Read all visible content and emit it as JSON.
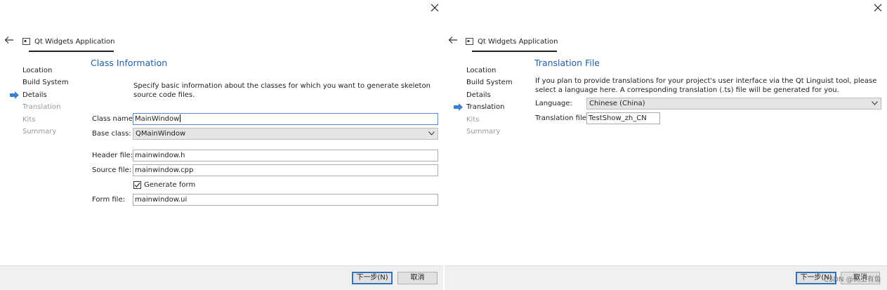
{
  "left": {
    "wizard_title": "Qt Widgets Application",
    "steps": [
      {
        "label": "Location",
        "state": "done"
      },
      {
        "label": "Build System",
        "state": "done"
      },
      {
        "label": "Details",
        "state": "current"
      },
      {
        "label": "Translation",
        "state": "pending"
      },
      {
        "label": "Kits",
        "state": "pending"
      },
      {
        "label": "Summary",
        "state": "pending"
      }
    ],
    "heading": "Class Information",
    "description": "Specify basic information about the classes for which you want to generate skeleton source code files.",
    "class_name": {
      "label": "Class name:",
      "value": "MainWindow"
    },
    "base_class": {
      "label": "Base class:",
      "value": "QMainWindow"
    },
    "header_file": {
      "label": "Header file:",
      "value": "mainwindow.h"
    },
    "source_file": {
      "label": "Source file:",
      "value": "mainwindow.cpp"
    },
    "generate_form": {
      "label": "Generate form",
      "checked": true
    },
    "form_file": {
      "label": "Form file:",
      "value": "mainwindow.ui"
    },
    "buttons": {
      "next": "下一步(N)",
      "cancel": "取消"
    }
  },
  "right": {
    "wizard_title": "Qt Widgets Application",
    "steps": [
      {
        "label": "Location",
        "state": "done"
      },
      {
        "label": "Build System",
        "state": "done"
      },
      {
        "label": "Details",
        "state": "done"
      },
      {
        "label": "Translation",
        "state": "current"
      },
      {
        "label": "Kits",
        "state": "pending"
      },
      {
        "label": "Summary",
        "state": "pending"
      }
    ],
    "heading": "Translation File",
    "description": "If you plan to provide translations for your project's user interface via the Qt Linguist tool, please select a language here. A corresponding translation (.ts) file will be generated for you.",
    "language": {
      "label": "Language:",
      "value": "Chinese (China)"
    },
    "translation_file": {
      "label": "Translation file:",
      "value": "TestShow_zh_CN"
    },
    "buttons": {
      "next": "下一步(N)",
      "cancel": "取消"
    },
    "watermark": "CSDN @码上有鱼"
  },
  "colors": {
    "heading": "#1f5fa8",
    "current_step_arrow": "#3b7fd1",
    "dim_step": "#9a9a9a",
    "default_button_border": "#2f74c0"
  },
  "icons": {
    "close": "close-icon",
    "back": "back-arrow-icon",
    "app": "application-icon",
    "current_step": "current-step-arrow-icon",
    "dropdown": "chevron-down-icon",
    "check": "checkmark-icon"
  }
}
